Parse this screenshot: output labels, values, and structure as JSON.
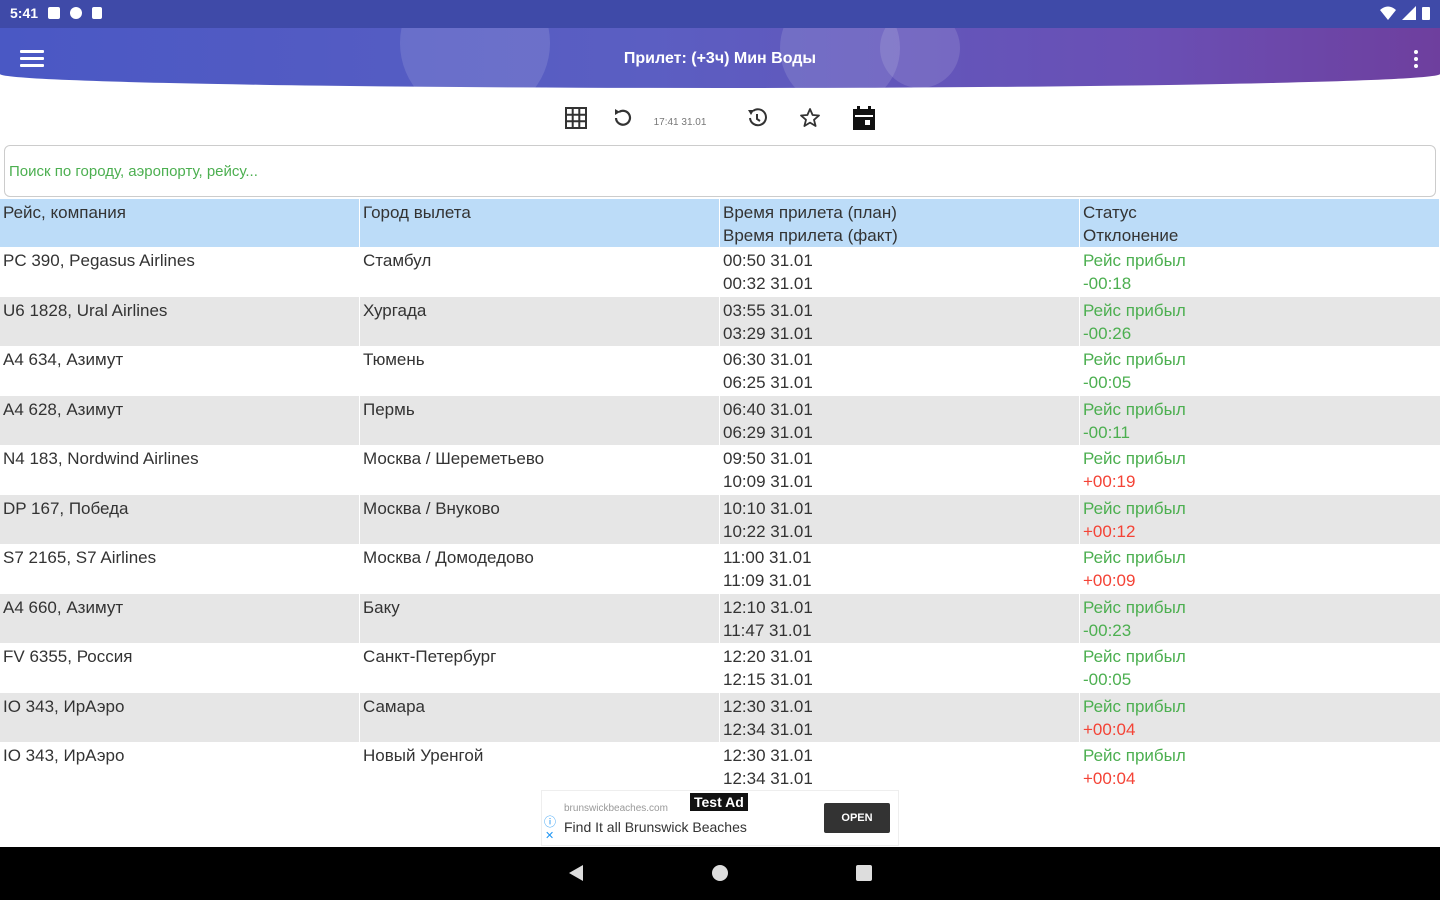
{
  "status_bar": {
    "time": "5:41"
  },
  "app_bar": {
    "title": "Прилет: (+3ч) Мин Воды"
  },
  "toolbar": {
    "updated_time": "17:41 31.01"
  },
  "search": {
    "placeholder": "Поиск по городу, аэропорту, рейсу..."
  },
  "table": {
    "headers": {
      "flight": "Рейс, компания",
      "city": "Город вылета",
      "time_plan": "Время прилета (план)",
      "time_fact": "Время прилета (факт)",
      "status": "Статус",
      "deviation": "Отклонение"
    },
    "rows": [
      {
        "flight": "PC 390, Pegasus Airlines",
        "city": "Стамбул",
        "plan": "00:50 31.01",
        "fact": "00:32 31.01",
        "status": "Рейс прибыл",
        "deviation": "-00:18"
      },
      {
        "flight": "U6 1828, Ural Airlines",
        "city": "Хургада",
        "plan": "03:55 31.01",
        "fact": "03:29 31.01",
        "status": "Рейс прибыл",
        "deviation": "-00:26"
      },
      {
        "flight": "A4 634, Азимут",
        "city": "Тюмень",
        "plan": "06:30 31.01",
        "fact": "06:25 31.01",
        "status": "Рейс прибыл",
        "deviation": "-00:05"
      },
      {
        "flight": "A4 628, Азимут",
        "city": "Пермь",
        "plan": "06:40 31.01",
        "fact": "06:29 31.01",
        "status": "Рейс прибыл",
        "deviation": "-00:11"
      },
      {
        "flight": "N4 183, Nordwind Airlines",
        "city": "Москва / Шереметьево",
        "plan": "09:50 31.01",
        "fact": "10:09 31.01",
        "status": "Рейс прибыл",
        "deviation": "+00:19"
      },
      {
        "flight": "DP 167, Победа",
        "city": "Москва / Внуково",
        "plan": "10:10 31.01",
        "fact": "10:22 31.01",
        "status": "Рейс прибыл",
        "deviation": "+00:12"
      },
      {
        "flight": "S7 2165, S7 Airlines",
        "city": "Москва / Домодедово",
        "plan": "11:00 31.01",
        "fact": "11:09 31.01",
        "status": "Рейс прибыл",
        "deviation": "+00:09"
      },
      {
        "flight": "A4 660, Азимут",
        "city": "Баку",
        "plan": "12:10 31.01",
        "fact": "11:47 31.01",
        "status": "Рейс прибыл",
        "deviation": "-00:23"
      },
      {
        "flight": "FV 6355, Россия",
        "city": "Санкт-Петербург",
        "plan": "12:20 31.01",
        "fact": "12:15 31.01",
        "status": "Рейс прибыл",
        "deviation": "-00:05"
      },
      {
        "flight": "IO 343, ИрАэро",
        "city": "Самара",
        "plan": "12:30 31.01",
        "fact": "12:34 31.01",
        "status": "Рейс прибыл",
        "deviation": "+00:04"
      },
      {
        "flight": "IO 343, ИрАэро",
        "city": "Новый Уренгой",
        "plan": "12:30 31.01",
        "fact": "12:34 31.01",
        "status": "Рейс прибыл",
        "deviation": "+00:04"
      }
    ]
  },
  "ad": {
    "tag": "Test Ad",
    "url": "brunswickbeaches.com",
    "text": "Find It all Brunswick Beaches",
    "button": "OPEN"
  },
  "colors": {
    "header_bg": "#bcdcf8",
    "alt_row_bg": "#e6e6e6",
    "early": "#4caf50",
    "late": "#f44336",
    "appbar_start": "#4a58c4",
    "appbar_end": "#6e3f9e"
  }
}
